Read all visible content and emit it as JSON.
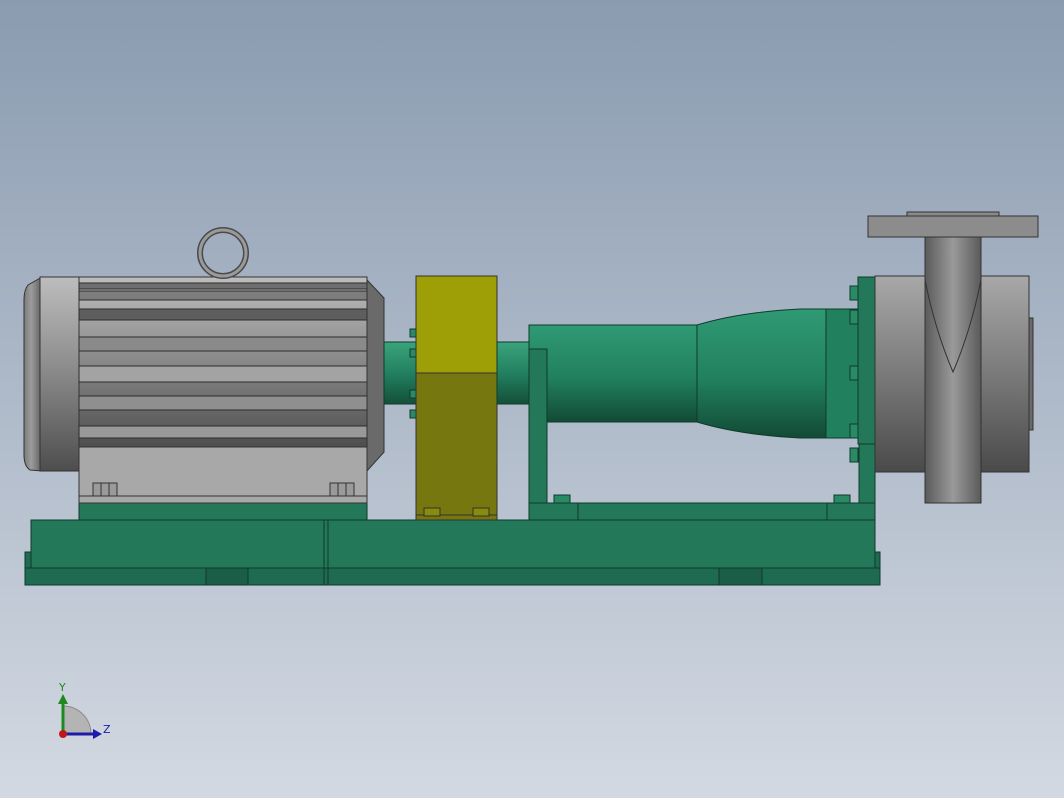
{
  "viewport": {
    "background_top": "#8a9bb0",
    "background_bottom": "#d3d9e2"
  },
  "colors": {
    "frame_green": "#23785a",
    "frame_green_dark": "#1b5a45",
    "pump_green": "#2a9470",
    "coupling_yellow": "#9a9a0a",
    "coupling_yellow_dark": "#75760c",
    "motor_gray": "#8e8e8e",
    "motor_gray_dark": "#5c5c5c",
    "casing_gray": "#7e7e7e"
  },
  "model": {
    "components": [
      "motor-icon",
      "lifting-eye-icon",
      "coupling-guard-icon",
      "pump-shaft-icon",
      "bearing-housing-icon",
      "volute-casing-icon",
      "discharge-flange-icon",
      "baseplate-icon"
    ]
  },
  "triad": {
    "y_label": "Y",
    "z_label": "Z",
    "y_color": "#1e8a1e",
    "z_color": "#1c1ca8",
    "origin_color": "#c01818"
  }
}
